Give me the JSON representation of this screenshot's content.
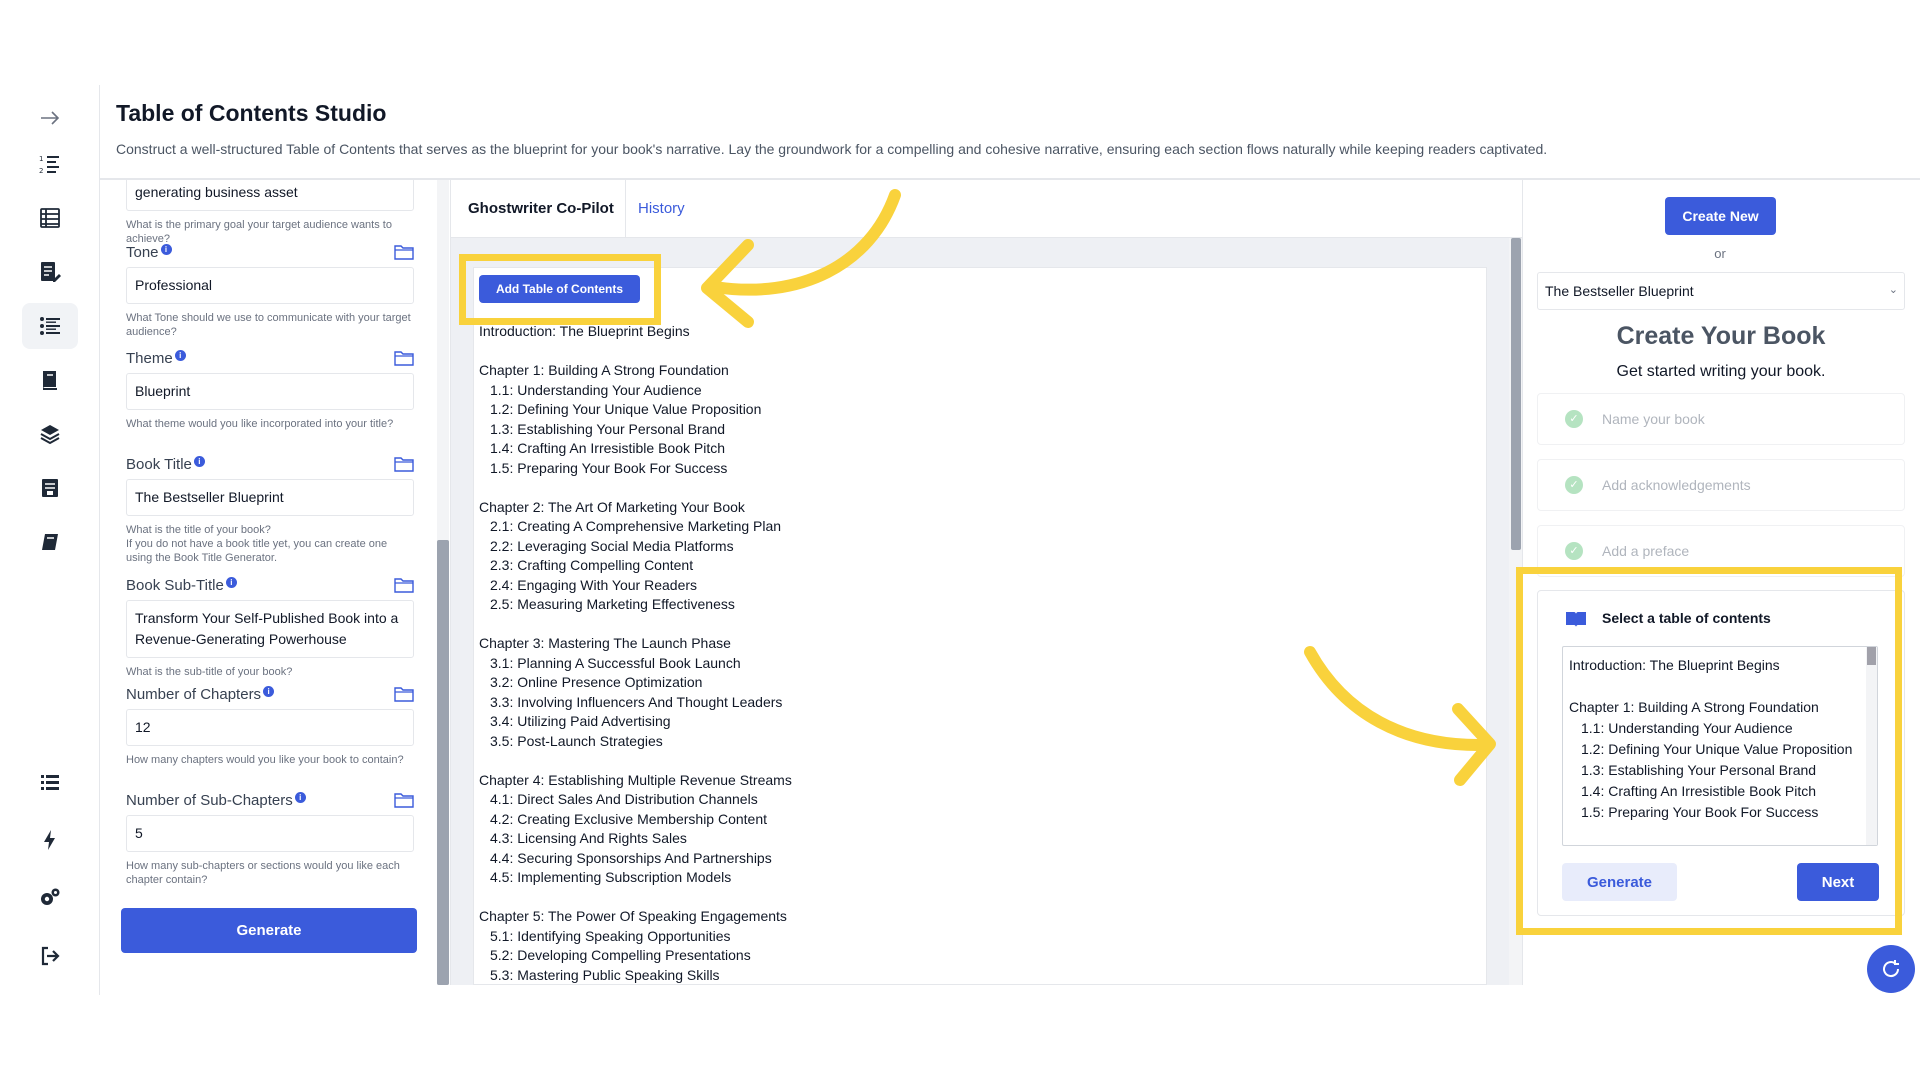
{
  "header": {
    "title": "Table of Contents Studio",
    "description": "Construct a well-structured Table of Contents that serves as the blueprint for your book's narrative. Lay the groundwork for a compelling and cohesive narrative, ensuring each section flows naturally while keeping readers captivated."
  },
  "sidebar": {
    "items": [
      {
        "icon": "arrow-right-icon"
      },
      {
        "icon": "numbered-list-icon"
      },
      {
        "icon": "table-icon"
      },
      {
        "icon": "edit-document-icon"
      },
      {
        "icon": "list-bullets-icon",
        "active": true
      },
      {
        "icon": "book-open-icon"
      },
      {
        "icon": "stack-books-icon"
      },
      {
        "icon": "archive-icon"
      },
      {
        "icon": "notebook-icon"
      },
      {
        "icon": "menu-list-icon"
      },
      {
        "icon": "lightning-icon"
      },
      {
        "icon": "settings-icon"
      },
      {
        "icon": "logout-icon"
      }
    ]
  },
  "form": {
    "goal_value": "generating business asset",
    "goal_help": "What is the primary goal your target audience wants to achieve?",
    "tone_label": "Tone",
    "tone_value": "Professional",
    "tone_help": "What Tone should we use to communicate with your target audience?",
    "theme_label": "Theme",
    "theme_value": "Blueprint",
    "theme_help": "What theme would you like incorporated into your title?",
    "book_title_label": "Book Title",
    "book_title_value": "The Bestseller Blueprint",
    "book_title_help": "What is the title of your book?",
    "book_title_help2": "If you do not have a book title yet, you can create one using the Book Title Generator.",
    "subtitle_label": "Book Sub-Title",
    "subtitle_value": "Transform Your Self-Published Book into a Revenue-Generating Powerhouse",
    "subtitle_help": "What is the sub-title of your book?",
    "chapters_label": "Number of Chapters",
    "chapters_value": "12",
    "chapters_help": "How many chapters would you like your book to contain?",
    "subchapters_label": "Number of Sub-Chapters",
    "subchapters_value": "5",
    "subchapters_help": "How many sub-chapters or sections would you like each chapter contain?",
    "generate_label": "Generate"
  },
  "middle": {
    "tabs": [
      "Ghostwriter Co-Pilot",
      "History"
    ],
    "add_button": "Add Table of Contents",
    "toc": [
      {
        "title": "Introduction: The Blueprint Begins",
        "subs": []
      },
      {
        "title": "Chapter 1: Building A Strong Foundation",
        "subs": [
          "1.1: Understanding Your Audience",
          "1.2: Defining Your Unique Value Proposition",
          "1.3: Establishing Your Personal Brand",
          "1.4: Crafting An Irresistible Book Pitch",
          "1.5: Preparing Your Book For Success"
        ]
      },
      {
        "title": "Chapter 2: The Art Of Marketing Your Book",
        "subs": [
          "2.1: Creating A Comprehensive Marketing Plan",
          "2.2: Leveraging Social Media Platforms",
          "2.3: Crafting Compelling Content",
          "2.4: Engaging With Your Readers",
          "2.5: Measuring Marketing Effectiveness"
        ]
      },
      {
        "title": "Chapter 3: Mastering The Launch Phase",
        "subs": [
          "3.1: Planning A Successful Book Launch",
          "3.2: Online Presence Optimization",
          "3.3: Involving Influencers And Thought Leaders",
          "3.4: Utilizing Paid Advertising",
          "3.5: Post-Launch Strategies"
        ]
      },
      {
        "title": "Chapter 4: Establishing Multiple Revenue Streams",
        "subs": [
          "4.1: Direct Sales And Distribution Channels",
          "4.2: Creating Exclusive Membership Content",
          "4.3: Licensing And Rights Sales",
          "4.4: Securing Sponsorships And Partnerships",
          "4.5: Implementing Subscription Models"
        ]
      },
      {
        "title": "Chapter 5: The Power Of Speaking Engagements",
        "subs": [
          "5.1: Identifying Speaking Opportunities",
          "5.2: Developing Compelling Presentations",
          "5.3: Mastering Public Speaking Skills"
        ]
      }
    ]
  },
  "right": {
    "create_new": "Create New",
    "or": "or",
    "selected_book": "The Bestseller Blueprint",
    "heading": "Create Your Book",
    "subheading": "Get started writing your book.",
    "steps": [
      "Name your book",
      "Add acknowledgements",
      "Add a preface"
    ],
    "card_title": "Select a table of contents",
    "card_toc": [
      {
        "title": "Introduction: The Blueprint Begins",
        "subs": []
      },
      {
        "title": "Chapter 1: Building A Strong Foundation",
        "subs": [
          "1.1: Understanding Your Audience",
          "1.2: Defining Your Unique Value Proposition",
          "1.3: Establishing Your Personal Brand",
          "1.4: Crafting An Irresistible Book Pitch",
          "1.5: Preparing Your Book For Success"
        ]
      }
    ],
    "generate_label": "Generate",
    "next_label": "Next"
  },
  "colors": {
    "accent": "#3b5bdb",
    "highlight": "#f9d23c"
  }
}
